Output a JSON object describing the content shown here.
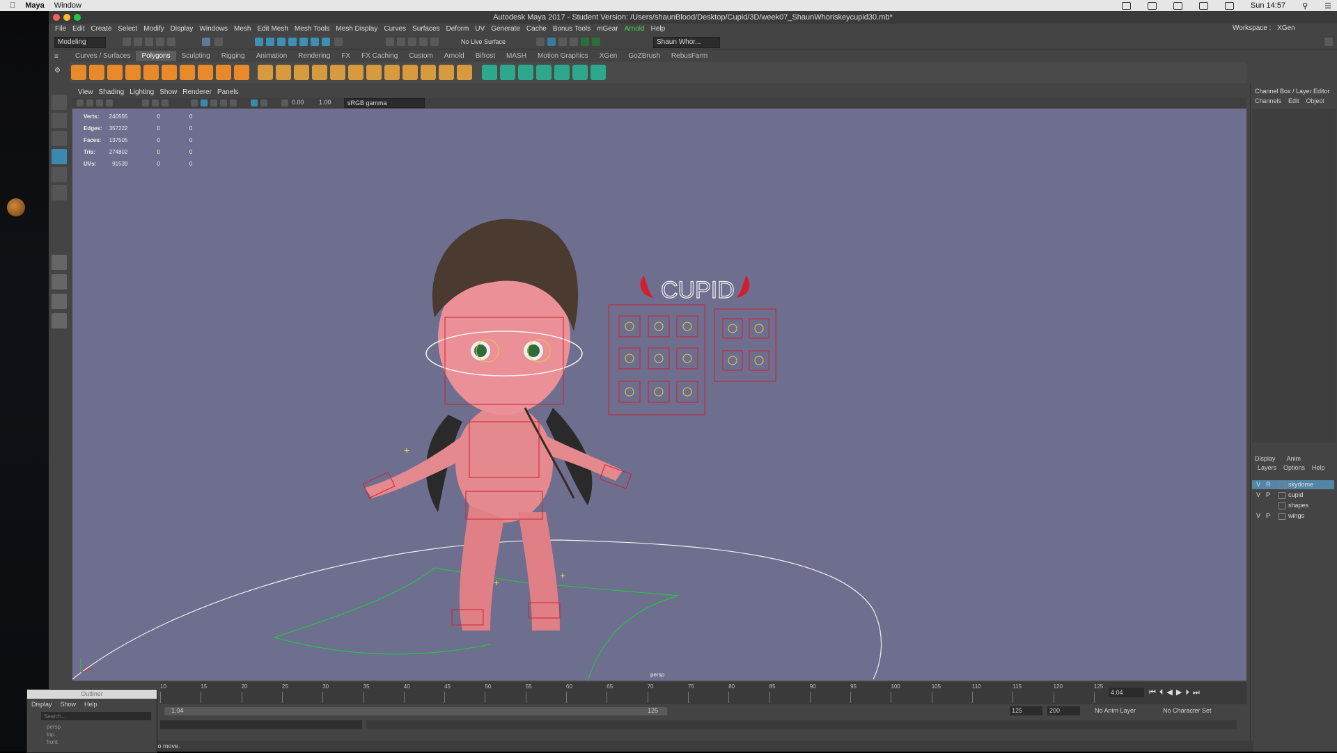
{
  "menubar": {
    "apple": "",
    "app": "Maya",
    "window_menu": "Window",
    "clock": "Sun 14:57"
  },
  "window": {
    "title": "Autodesk Maya 2017 - Student Version: /Users/shaunBlood/Desktop/Cupid/3D/week07_ShaunWhoriskeycupid30.mb*"
  },
  "main_menu": [
    "File",
    "Edit",
    "Create",
    "Select",
    "Modify",
    "Display",
    "Windows",
    "Mesh",
    "Edit Mesh",
    "Mesh Tools",
    "Mesh Display",
    "Curves",
    "Surfaces",
    "Deform",
    "UV",
    "Generate",
    "Cache",
    "Bonus Tools",
    "mGear",
    "Arnold",
    "Help"
  ],
  "workspace": {
    "label": "Workspace :",
    "value": "XGen"
  },
  "status_line": {
    "mode": "Modeling",
    "live_surface": "No Live Surface",
    "user": "Shaun Whor..."
  },
  "shelf_tabs": [
    "Curves / Surfaces",
    "Polygons",
    "Sculpting",
    "Rigging",
    "Animation",
    "Rendering",
    "FX",
    "FX Caching",
    "Custom",
    "Arnold",
    "Bifrost",
    "MASH",
    "Motion Graphics",
    "XGen",
    "GoZBrush",
    "RebusFarm"
  ],
  "shelf_active": "Polygons",
  "viewport_menu": [
    "View",
    "Shading",
    "Lighting",
    "Show",
    "Renderer",
    "Panels"
  ],
  "viewport_toolbar": {
    "exposure": "0.00",
    "gamma": "1.00",
    "color_space": "sRGB gamma"
  },
  "hud": [
    {
      "label": "Verts:",
      "v1": "240555",
      "v2": "0",
      "v3": "0"
    },
    {
      "label": "Edges:",
      "v1": "357222",
      "v2": "0",
      "v3": "0"
    },
    {
      "label": "Faces:",
      "v1": "137505",
      "v2": "0",
      "v3": "0"
    },
    {
      "label": "Tris:",
      "v1": "274802",
      "v2": "0",
      "v3": "0"
    },
    {
      "label": "UVs:",
      "v1": "91539",
      "v2": "0",
      "v3": "0"
    }
  ],
  "camera": "persp",
  "scene_text": {
    "logo": "CUPID"
  },
  "channel_box": {
    "title": "Channel Box / Layer Editor",
    "tabs": [
      "Channels",
      "Edit",
      "Object"
    ]
  },
  "layer_editor": {
    "tabs": [
      "Display",
      "Anim"
    ],
    "menu": [
      "Layers",
      "Options",
      "Help"
    ],
    "layers": [
      {
        "v": "V",
        "p": "R",
        "name": "skydome",
        "selected": true
      },
      {
        "v": "V",
        "p": "P",
        "name": "cupid",
        "selected": false
      },
      {
        "v": "",
        "p": "",
        "name": "shapes",
        "selected": false
      },
      {
        "v": "V",
        "p": "P",
        "name": "wings",
        "selected": false
      }
    ]
  },
  "timeline": {
    "ticks": [
      "10",
      "15",
      "20",
      "25",
      "30",
      "35",
      "40",
      "45",
      "50",
      "55",
      "60",
      "65",
      "70",
      "75",
      "80",
      "85",
      "90",
      "95",
      "100",
      "105",
      "110",
      "115",
      "120",
      "125"
    ],
    "current_frame": "4.04"
  },
  "range": {
    "start": "1.04",
    "range_end": "125",
    "end": "125",
    "anim_end": "200",
    "anim_layer": "No Anim Layer",
    "char_set": "No Character Set"
  },
  "outliner": {
    "title": "Outliner",
    "menu": [
      "Display",
      "Show",
      "Help"
    ],
    "search_placeholder": "Search...",
    "items": [
      "persp",
      "top",
      "front"
    ]
  },
  "help_line": "to move."
}
